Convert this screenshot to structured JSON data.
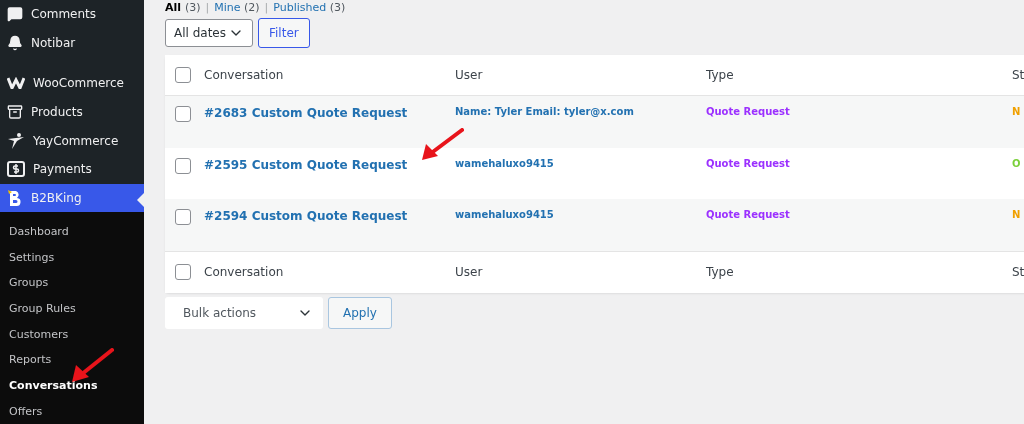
{
  "sidebar": {
    "items": [
      {
        "label": "Comments",
        "kind": "comment",
        "selected": false
      },
      {
        "label": "Notibar",
        "kind": "bell",
        "selected": false
      },
      {
        "label": "WooCommerce",
        "kind": "woo",
        "selected": false,
        "gap_before": true
      },
      {
        "label": "Products",
        "kind": "box",
        "selected": false
      },
      {
        "label": "YayCommerce",
        "kind": "figure",
        "selected": false
      },
      {
        "label": "Payments",
        "kind": "dollar",
        "selected": false
      },
      {
        "label": "B2BKing",
        "kind": "b",
        "selected": true
      }
    ],
    "submenu": [
      {
        "label": "Dashboard",
        "selected": false
      },
      {
        "label": "Settings",
        "selected": false
      },
      {
        "label": "Groups",
        "selected": false
      },
      {
        "label": "Group Rules",
        "selected": false
      },
      {
        "label": "Customers",
        "selected": false
      },
      {
        "label": "Reports",
        "selected": false
      },
      {
        "label": "Conversations",
        "selected": true
      },
      {
        "label": "Offers",
        "selected": false
      }
    ]
  },
  "views": [
    {
      "label": "All",
      "count": "(3)",
      "selected": true
    },
    {
      "label": "Mine",
      "count": "(2)",
      "selected": false
    },
    {
      "label": "Published",
      "count": "(3)",
      "selected": false
    }
  ],
  "view_separator": "|",
  "date_filter": {
    "value": "All dates"
  },
  "filter_button": "Filter",
  "table": {
    "columns": [
      "Conversation",
      "User",
      "Type",
      "St"
    ],
    "rows": [
      {
        "conversation": "#2683 Custom Quote Request",
        "user": "Name: Tyler Email: tyler@x.com",
        "type": "Quote Request",
        "status": "N",
        "color": "#f0a000",
        "checked": false
      },
      {
        "conversation": "#2595 Custom Quote Request",
        "user": "wamehaluxo9415",
        "type": "Quote Request",
        "status": "O",
        "color": "#7ad03a",
        "checked": false
      },
      {
        "conversation": "#2594 Custom Quote Request",
        "user": "wamehaluxo9415",
        "type": "Quote Request",
        "status": "N",
        "color": "#f0a000",
        "checked": false
      }
    ],
    "header_checked": false,
    "footer_checked": false,
    "footer_columns": [
      "Conversation",
      "User",
      "Type",
      "St"
    ]
  },
  "bulk_actions": {
    "value": "Bulk actions"
  },
  "apply_button": "Apply"
}
